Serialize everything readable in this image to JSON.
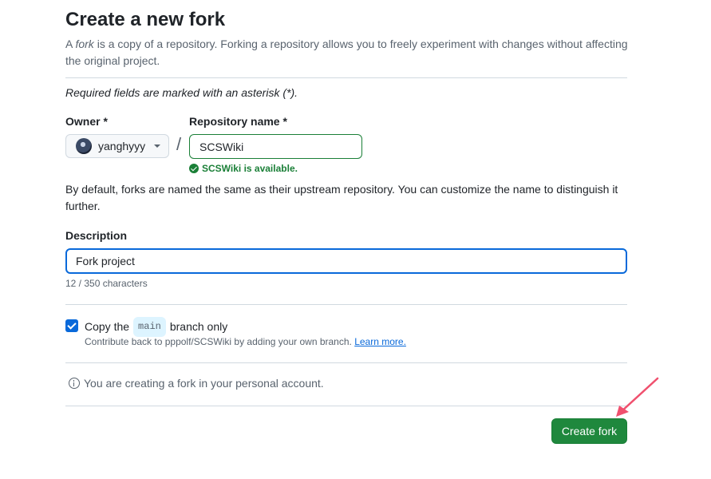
{
  "header": {
    "title": "Create a new fork",
    "intro_prefix": "A ",
    "intro_em": "fork",
    "intro_rest": " is a copy of a repository. Forking a repository allows you to freely experiment with changes without affecting the original project."
  },
  "form": {
    "required_note": "Required fields are marked with an asterisk (*).",
    "owner_label": "Owner *",
    "owner_value": "yanghyyy",
    "separator": "/",
    "repo_label": "Repository name *",
    "repo_value": "SCSWiki",
    "availability": "SCSWiki is available.",
    "naming_note": "By default, forks are named the same as their upstream repository. You can customize the name to distinguish it further.",
    "description_label": "Description",
    "description_value": "Fork project",
    "char_count": "12 / 350 characters",
    "copy_prefix": "Copy the",
    "copy_branch": "main",
    "copy_suffix": "branch only",
    "copy_checked": true,
    "contribute_text": "Contribute back to pppolf/SCSWiki by adding your own branch.",
    "learn_more": "Learn more.",
    "info_text": "You are creating a fork in your personal account.",
    "submit_label": "Create fork"
  },
  "colors": {
    "primary_button": "#1f883d",
    "focus_border": "#0969da",
    "success": "#1a7f37",
    "annotation_arrow": "#f0506e"
  }
}
